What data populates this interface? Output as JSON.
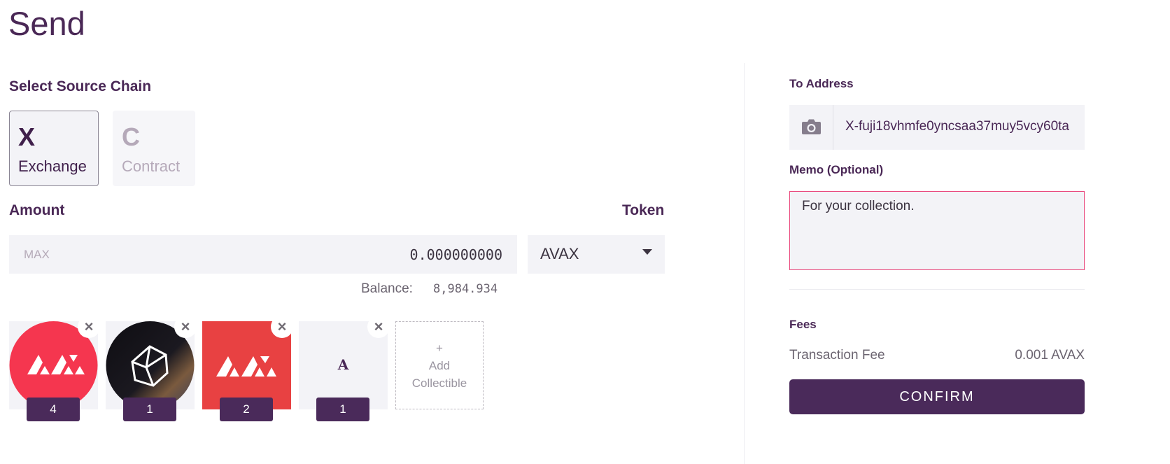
{
  "page": {
    "title": "Send"
  },
  "source_chain": {
    "heading": "Select Source Chain",
    "options": [
      {
        "letter": "X",
        "name": "Exchange",
        "selected": true
      },
      {
        "letter": "C",
        "name": "Contract",
        "selected": false
      }
    ]
  },
  "amount": {
    "label": "Amount",
    "max_label": "MAX",
    "value": "0.000000000",
    "balance_label": "Balance:",
    "balance_value": "8,984.934"
  },
  "token": {
    "label": "Token",
    "selected": "AVAX"
  },
  "collectibles": {
    "items": [
      {
        "icon": "avalanche-logo-circle-icon",
        "count": "4"
      },
      {
        "icon": "polyhedron-nft-icon",
        "count": "1"
      },
      {
        "icon": "avalanche-logo-square-icon",
        "count": "2"
      },
      {
        "icon": "letter-a-icon",
        "glyph": "A",
        "count": "1"
      }
    ],
    "add_plus": "+",
    "add_label": "Add Collectible"
  },
  "to_address": {
    "label": "To Address",
    "value": "X-fuji18vhmfe0yncsaa37muy5vcy60ta"
  },
  "memo": {
    "label": "Memo (Optional)",
    "value": "For your collection."
  },
  "fees": {
    "label": "Fees",
    "transaction_fee_label": "Transaction Fee",
    "transaction_fee_value": "0.001 AVAX"
  },
  "confirm_label": "CONFIRM",
  "colors": {
    "brand_purple": "#4a2a5a",
    "avax_red": "#e84142",
    "avax_pink": "#f5364f",
    "memo_border": "#e9457a"
  }
}
